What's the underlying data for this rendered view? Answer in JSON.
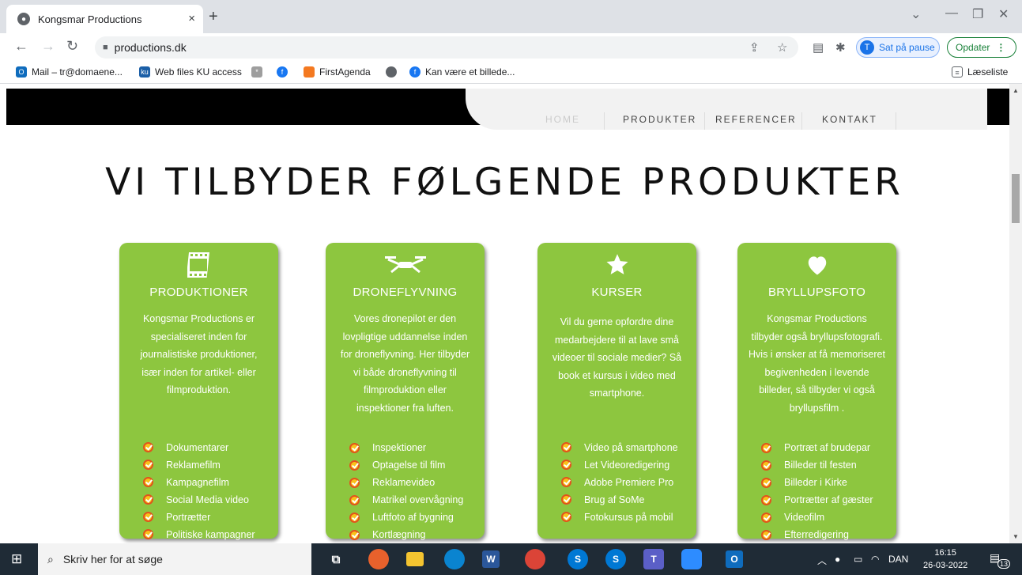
{
  "browser": {
    "tab_title": "Kongsmar Productions",
    "tab_close": "×",
    "new_tab": "+",
    "url": "productions.dk",
    "profile_initial": "T",
    "profile_label": "Sat på pause",
    "update_label": "Opdater",
    "bookmarks": [
      "Mail – tr@domaene...",
      "Web files KU access",
      "FirstAgenda",
      "Kan være et billede..."
    ],
    "reading_list": "Læseliste"
  },
  "nav": {
    "items": [
      "HOME",
      "PRODUKTER",
      "REFERENCER",
      "KONTAKT"
    ]
  },
  "page": {
    "heading": "VI TILBYDER FØLGENDE PRODUKTER"
  },
  "cards": [
    {
      "icon": "film-icon",
      "title": "PRODUKTIONER",
      "desc": [
        "Kongsmar Productions er",
        "specialiseret inden for",
        "journalistiske produktioner,",
        "især inden for artikel- eller",
        "filmproduktion."
      ],
      "items": [
        "Dokumentarer",
        "Reklamefilm",
        "Kampagnefilm",
        "Social Media video",
        "Portrætter",
        "Politiske kampagner"
      ]
    },
    {
      "icon": "drone-icon",
      "title": "DRONEFLYVNING",
      "desc": [
        "Vores dronepilot er den",
        "lovpligtige uddannelse inden",
        "for droneflyvning. Her tilbyder",
        "vi både droneflyvning til",
        "filmproduktion eller",
        "inspektioner fra luften."
      ],
      "items": [
        "Inspektioner",
        "Optagelse til film",
        "Reklamevideo",
        "Matrikel overvågning",
        "Luftfoto af bygning",
        "Kortlægning"
      ]
    },
    {
      "icon": "star-icon",
      "title": "KURSER",
      "desc": [
        "Vil du gerne opfordre dine",
        "medarbejdere til at lave små",
        "videoer til sociale medier? Så",
        "book et kursus i video med",
        "smartphone."
      ],
      "items": [
        "Video på smartphone",
        "Let Videoredigering",
        "Adobe Premiere Pro",
        "Brug af SoMe",
        "Fotokursus på mobil"
      ]
    },
    {
      "icon": "heart-icon",
      "title": "BRYLLUPSFOTO",
      "desc": [
        "Kongsmar Productions",
        "tilbyder også bryllupsfotografi.",
        "Hvis i ønsker at få memoriseret",
        "begivenheden i levende",
        "billeder, så tilbyder vi også",
        "bryllupsfilm ."
      ],
      "items": [
        "Portræt af brudepar",
        "Billeder til festen",
        "Billeder i Kirke",
        "Portrætter af gæster",
        "Videofilm",
        "Efterredigering"
      ]
    }
  ],
  "taskbar": {
    "search_placeholder": "Skriv her for at søge",
    "language": "DAN",
    "time": "16:15",
    "date": "26-03-2022",
    "notification_count": "13"
  }
}
